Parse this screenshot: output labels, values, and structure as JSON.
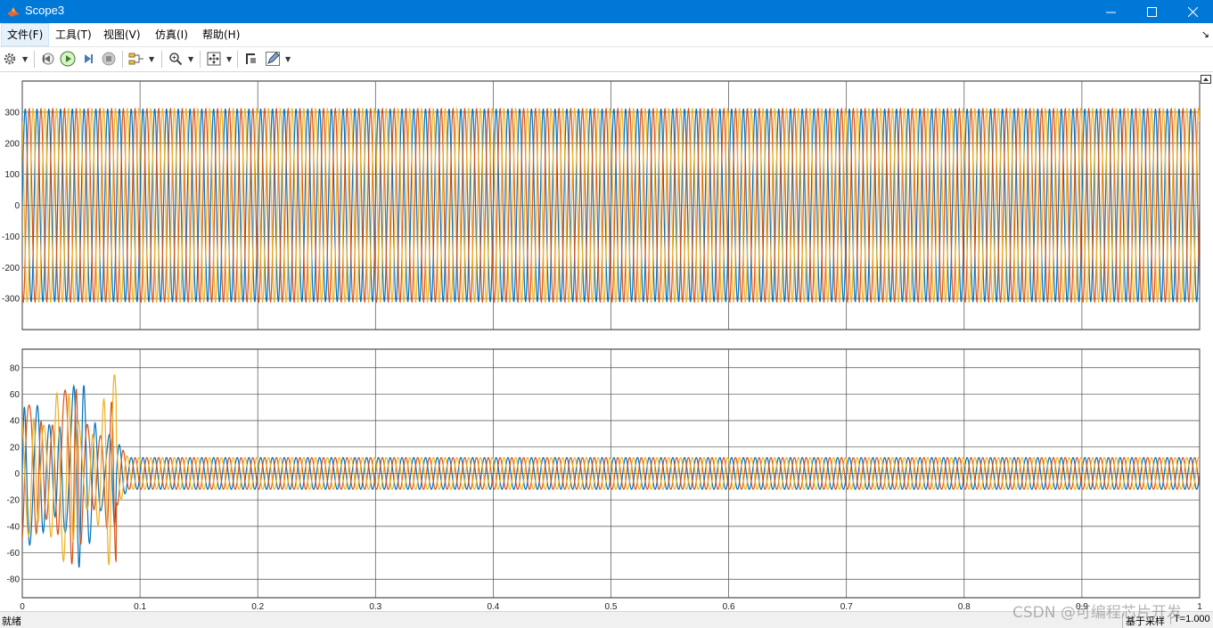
{
  "window": {
    "title": "Scope3",
    "buttons": [
      "minimize",
      "maximize",
      "close"
    ]
  },
  "menu": {
    "items": [
      "文件(F)",
      "工具(T)",
      "视图(V)",
      "仿真(I)",
      "帮助(H)"
    ],
    "overflow_icon": "arrow-icon"
  },
  "toolbar": {
    "icons": [
      "gear-icon",
      "step-back-icon",
      "run-icon",
      "step-forward-icon",
      "stop-icon",
      "signal-config-icon",
      "zoom-icon",
      "fit-axes-icon",
      "highlight-block-icon",
      "edit-icon"
    ]
  },
  "colors": {
    "phase_a": "#0072bd",
    "phase_b": "#d95319",
    "phase_c": "#edb120",
    "titlebar": "#0078d7",
    "grid": "#4d4d4d"
  },
  "chart_data": [
    {
      "type": "line",
      "title": "",
      "xlabel": "",
      "ylabel": "",
      "xlim": [
        0,
        1
      ],
      "ylim": [
        -400,
        400
      ],
      "yticks": [
        -300,
        -200,
        -100,
        0,
        100,
        200,
        300
      ],
      "xticks": [
        0,
        0.1,
        0.2,
        0.3,
        0.4,
        0.5,
        0.6,
        0.7,
        0.8,
        0.9,
        1
      ],
      "grid": true,
      "series": [
        {
          "color": "#0072bd",
          "amplitude": 311,
          "frequency_hz": 100,
          "phase_deg": 0
        },
        {
          "color": "#d95319",
          "amplitude": 311,
          "frequency_hz": 100,
          "phase_deg": -120
        },
        {
          "color": "#edb120",
          "amplitude": 311,
          "frequency_hz": 100,
          "phase_deg": 120
        }
      ]
    },
    {
      "type": "line",
      "title": "",
      "xlabel": "",
      "ylabel": "",
      "xlim": [
        0,
        1
      ],
      "ylim": [
        -94,
        94
      ],
      "yticks": [
        -80,
        -60,
        -40,
        -20,
        0,
        20,
        40,
        60,
        80
      ],
      "xticks": [
        0,
        0.1,
        0.2,
        0.3,
        0.4,
        0.5,
        0.6,
        0.7,
        0.8,
        0.9,
        1
      ],
      "xticklabels": [
        "0",
        "0.1",
        "0.2",
        "0.3",
        "0.4",
        "0.5",
        "0.6",
        "0.7",
        "0.8",
        "0.9",
        "1"
      ],
      "grid": true,
      "transient": {
        "end_time": 0.08,
        "peak_positive": 75,
        "peak_negative": -80
      },
      "series": [
        {
          "color": "#0072bd",
          "steady_amplitude": 12,
          "frequency_hz": 100,
          "phase_deg": 0
        },
        {
          "color": "#d95319",
          "steady_amplitude": 12,
          "frequency_hz": 100,
          "phase_deg": -120
        },
        {
          "color": "#edb120",
          "steady_amplitude": 12,
          "frequency_hz": 100,
          "phase_deg": 120
        }
      ]
    }
  ],
  "status": {
    "ready": "就绪",
    "mode": "基于采样",
    "time": "T=1.000"
  },
  "watermark": "CSDN @可编程芯片开发"
}
